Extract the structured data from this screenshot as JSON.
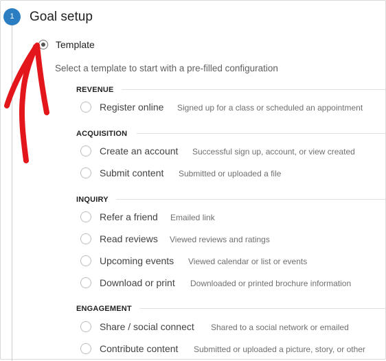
{
  "step": {
    "number": "1",
    "title": "Goal setup"
  },
  "template_option": {
    "label": "Template",
    "selected": true,
    "helper": "Select a template to start with a pre-filled configuration"
  },
  "annotation": {
    "arrow_color": "#e3171b"
  },
  "colors": {
    "accent": "#2b7ec1"
  },
  "sections": [
    {
      "header": "REVENUE",
      "options": [
        {
          "name": "Register online",
          "desc": "Signed up for a class or scheduled an appointment"
        }
      ]
    },
    {
      "header": "ACQUISITION",
      "options": [
        {
          "name": "Create an account",
          "desc": "Successful sign up, account, or view created"
        },
        {
          "name": "Submit content",
          "desc": "Submitted or uploaded a file"
        }
      ]
    },
    {
      "header": "INQUIRY",
      "options": [
        {
          "name": "Refer a friend",
          "desc": "Emailed link"
        },
        {
          "name": "Read reviews",
          "desc": "Viewed reviews and ratings"
        },
        {
          "name": "Upcoming events",
          "desc": "Viewed calendar or list or events"
        },
        {
          "name": "Download or print",
          "desc": "Downloaded or printed brochure information"
        }
      ]
    },
    {
      "header": "ENGAGEMENT",
      "options": [
        {
          "name": "Share / social connect",
          "desc": "Shared to a social network or emailed"
        },
        {
          "name": "Contribute content",
          "desc": "Submitted or uploaded a picture, story, or other"
        }
      ]
    }
  ]
}
